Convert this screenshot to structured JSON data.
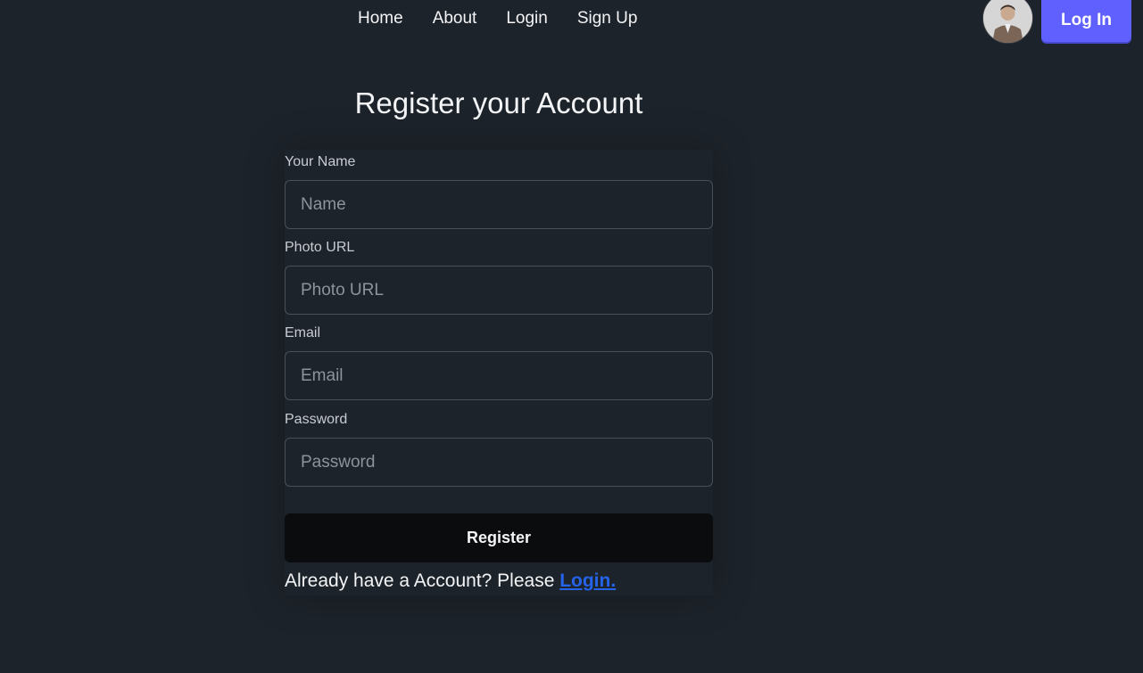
{
  "nav": {
    "links": [
      "Home",
      "About",
      "Login",
      "Sign Up"
    ],
    "login_button": "Log In"
  },
  "title": "Register your Account",
  "form": {
    "name_label": "Your Name",
    "name_placeholder": "Name",
    "photo_label": "Photo URL",
    "photo_placeholder": "Photo URL",
    "email_label": "Email",
    "email_placeholder": "Email",
    "password_label": "Password",
    "password_placeholder": "Password",
    "submit_label": "Register"
  },
  "footer": {
    "text": "Already have a Account? Please ",
    "link": "Login."
  },
  "colors": {
    "background": "#1d232a",
    "primary_button": "#6060ff",
    "link": "#2563eb",
    "submit_button": "#0b0c0e"
  }
}
